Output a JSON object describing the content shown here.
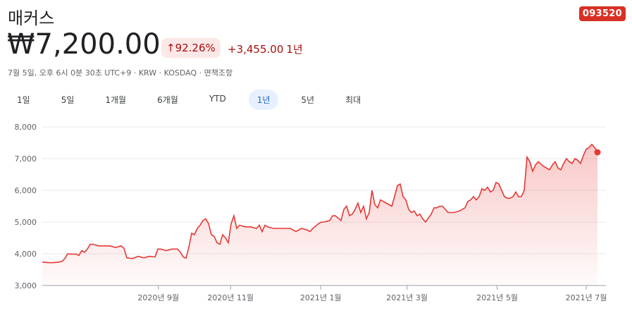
{
  "stock": {
    "name": "매커스",
    "ticker": "093520",
    "price": "₩7,200.00",
    "change_pct": "↑92.26%",
    "change_abs": "+3,455.00",
    "change_period": "1년",
    "meta": "7월 5일, 오후 6시 0분 30초 UTC+9 · KRW · KOSDAQ · 면책조항"
  },
  "tabs": [
    "1일",
    "5일",
    "1개월",
    "6개월",
    "YTD",
    "1년",
    "5년",
    "최대"
  ],
  "active_tab": "1년",
  "colors": {
    "accent": "#d93025",
    "line": "#e53935",
    "badge_bg": "#fce8e6",
    "tab_active_bg": "#e8f0fe"
  },
  "chart_data": {
    "type": "area",
    "ylim": [
      3000,
      8000
    ],
    "yticks": [
      3000,
      4000,
      5000,
      6000,
      7000,
      8000
    ],
    "ytick_labels": [
      "3,000",
      "4,000",
      "5,000",
      "6,000",
      "7,000",
      "8,000"
    ],
    "xticks": [
      {
        "label": "2020년 9월",
        "x": 0.206
      },
      {
        "label": "2020년 11월",
        "x": 0.334
      },
      {
        "label": "2021년 1월",
        "x": 0.494
      },
      {
        "label": "2021년 3월",
        "x": 0.647
      },
      {
        "label": "2021년 5월",
        "x": 0.807
      },
      {
        "label": "2021년 7월",
        "x": 0.965
      }
    ],
    "series": [
      {
        "points": [
          [
            0.0,
            3740
          ],
          [
            0.01,
            3720
          ],
          [
            0.02,
            3720
          ],
          [
            0.03,
            3740
          ],
          [
            0.035,
            3760
          ],
          [
            0.04,
            3850
          ],
          [
            0.045,
            4000
          ],
          [
            0.05,
            3990
          ],
          [
            0.06,
            3990
          ],
          [
            0.065,
            3950
          ],
          [
            0.07,
            4100
          ],
          [
            0.075,
            4050
          ],
          [
            0.08,
            4150
          ],
          [
            0.085,
            4300
          ],
          [
            0.09,
            4300
          ],
          [
            0.1,
            4250
          ],
          [
            0.11,
            4250
          ],
          [
            0.12,
            4250
          ],
          [
            0.13,
            4200
          ],
          [
            0.14,
            4250
          ],
          [
            0.145,
            4170
          ],
          [
            0.15,
            3870
          ],
          [
            0.16,
            3850
          ],
          [
            0.17,
            3920
          ],
          [
            0.18,
            3870
          ],
          [
            0.19,
            3920
          ],
          [
            0.2,
            3900
          ],
          [
            0.205,
            4150
          ],
          [
            0.21,
            4150
          ],
          [
            0.22,
            4100
          ],
          [
            0.23,
            4150
          ],
          [
            0.24,
            4150
          ],
          [
            0.245,
            4050
          ],
          [
            0.25,
            3900
          ],
          [
            0.255,
            3860
          ],
          [
            0.26,
            4200
          ],
          [
            0.265,
            4650
          ],
          [
            0.27,
            4600
          ],
          [
            0.275,
            4800
          ],
          [
            0.28,
            4900
          ],
          [
            0.285,
            5050
          ],
          [
            0.29,
            5100
          ],
          [
            0.295,
            4950
          ],
          [
            0.3,
            4600
          ],
          [
            0.305,
            4550
          ],
          [
            0.31,
            4350
          ],
          [
            0.315,
            4300
          ],
          [
            0.32,
            4600
          ],
          [
            0.325,
            4500
          ],
          [
            0.33,
            4350
          ],
          [
            0.335,
            4950
          ],
          [
            0.34,
            5200
          ],
          [
            0.345,
            4800
          ],
          [
            0.35,
            4900
          ],
          [
            0.36,
            4850
          ],
          [
            0.37,
            4850
          ],
          [
            0.38,
            4800
          ],
          [
            0.385,
            4900
          ],
          [
            0.39,
            4700
          ],
          [
            0.395,
            4900
          ],
          [
            0.4,
            4850
          ],
          [
            0.41,
            4800
          ],
          [
            0.42,
            4800
          ],
          [
            0.43,
            4800
          ],
          [
            0.44,
            4800
          ],
          [
            0.45,
            4700
          ],
          [
            0.46,
            4800
          ],
          [
            0.47,
            4750
          ],
          [
            0.475,
            4700
          ],
          [
            0.48,
            4800
          ],
          [
            0.49,
            4950
          ],
          [
            0.495,
            5000
          ],
          [
            0.5,
            5000
          ],
          [
            0.51,
            5050
          ],
          [
            0.515,
            5200
          ],
          [
            0.52,
            5200
          ],
          [
            0.53,
            5050
          ],
          [
            0.535,
            5400
          ],
          [
            0.54,
            5500
          ],
          [
            0.545,
            5200
          ],
          [
            0.55,
            5250
          ],
          [
            0.555,
            5400
          ],
          [
            0.56,
            5600
          ],
          [
            0.565,
            5300
          ],
          [
            0.57,
            5500
          ],
          [
            0.575,
            5100
          ],
          [
            0.58,
            5300
          ],
          [
            0.585,
            6000
          ],
          [
            0.59,
            5550
          ],
          [
            0.595,
            5450
          ],
          [
            0.6,
            5700
          ],
          [
            0.605,
            5650
          ],
          [
            0.61,
            5600
          ],
          [
            0.62,
            5500
          ],
          [
            0.625,
            5800
          ],
          [
            0.63,
            6150
          ],
          [
            0.635,
            6200
          ],
          [
            0.64,
            5800
          ],
          [
            0.645,
            5700
          ],
          [
            0.65,
            5400
          ],
          [
            0.655,
            5300
          ],
          [
            0.66,
            5350
          ],
          [
            0.665,
            5200
          ],
          [
            0.67,
            5250
          ],
          [
            0.675,
            5100
          ],
          [
            0.68,
            5000
          ],
          [
            0.69,
            5250
          ],
          [
            0.695,
            5450
          ],
          [
            0.7,
            5450
          ],
          [
            0.705,
            5500
          ],
          [
            0.71,
            5500
          ],
          [
            0.72,
            5300
          ],
          [
            0.73,
            5300
          ],
          [
            0.74,
            5350
          ],
          [
            0.75,
            5450
          ],
          [
            0.755,
            5650
          ],
          [
            0.76,
            5700
          ],
          [
            0.765,
            5800
          ],
          [
            0.77,
            5700
          ],
          [
            0.775,
            5800
          ],
          [
            0.78,
            6050
          ],
          [
            0.785,
            6000
          ],
          [
            0.79,
            6100
          ],
          [
            0.795,
            5950
          ],
          [
            0.8,
            6000
          ],
          [
            0.805,
            6250
          ],
          [
            0.81,
            6200
          ],
          [
            0.815,
            6000
          ],
          [
            0.82,
            5800
          ],
          [
            0.825,
            5750
          ],
          [
            0.83,
            5750
          ],
          [
            0.835,
            5800
          ],
          [
            0.84,
            5950
          ],
          [
            0.845,
            5800
          ],
          [
            0.85,
            5800
          ],
          [
            0.855,
            6000
          ],
          [
            0.86,
            7050
          ],
          [
            0.865,
            6900
          ],
          [
            0.87,
            6600
          ],
          [
            0.875,
            6800
          ],
          [
            0.88,
            6900
          ],
          [
            0.89,
            6750
          ],
          [
            0.895,
            6700
          ],
          [
            0.9,
            6650
          ],
          [
            0.905,
            6800
          ],
          [
            0.91,
            6900
          ],
          [
            0.915,
            6700
          ],
          [
            0.92,
            6650
          ],
          [
            0.925,
            6850
          ],
          [
            0.93,
            7000
          ],
          [
            0.935,
            6900
          ],
          [
            0.94,
            6850
          ],
          [
            0.945,
            7000
          ],
          [
            0.95,
            6950
          ],
          [
            0.955,
            6850
          ],
          [
            0.96,
            7100
          ],
          [
            0.965,
            7300
          ],
          [
            0.97,
            7350
          ],
          [
            0.975,
            7450
          ],
          [
            0.98,
            7350
          ],
          [
            0.985,
            7200
          ]
        ]
      }
    ]
  }
}
